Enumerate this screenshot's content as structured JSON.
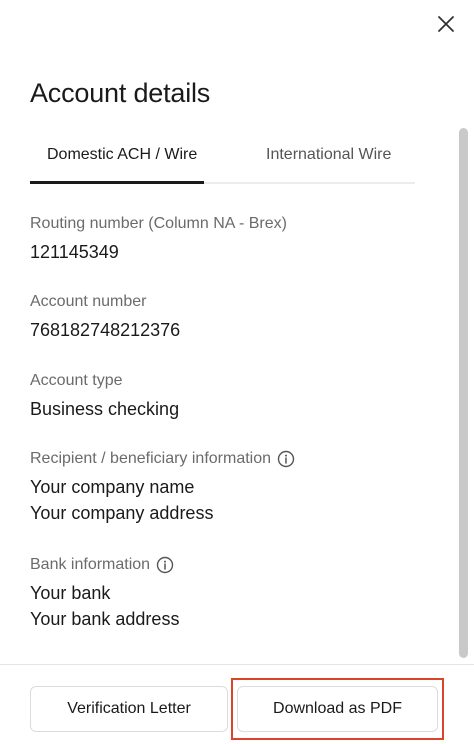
{
  "dialog": {
    "title": "Account details",
    "close_icon": "close-icon"
  },
  "tabs": [
    {
      "label": "Domestic ACH / Wire",
      "active": true
    },
    {
      "label": "International Wire",
      "active": false
    }
  ],
  "fields": {
    "routing": {
      "label": "Routing number (Column NA - Brex)",
      "value": "121145349"
    },
    "account_number": {
      "label": "Account number",
      "value": "768182748212376"
    },
    "account_type": {
      "label": "Account type",
      "value": "Business checking"
    },
    "recipient": {
      "label": "Recipient / beneficiary information",
      "icon": "info-icon",
      "line1": "Your company name",
      "line2": "Your company address"
    },
    "bank": {
      "label": "Bank information",
      "icon": "info-icon",
      "line1": "Your bank",
      "line2": "Your bank address"
    }
  },
  "footer": {
    "verification_label": "Verification Letter",
    "download_label": "Download as PDF"
  },
  "colors": {
    "highlight": "#d9442b",
    "text": "#1a1a1a",
    "muted": "#6b6b6b"
  }
}
